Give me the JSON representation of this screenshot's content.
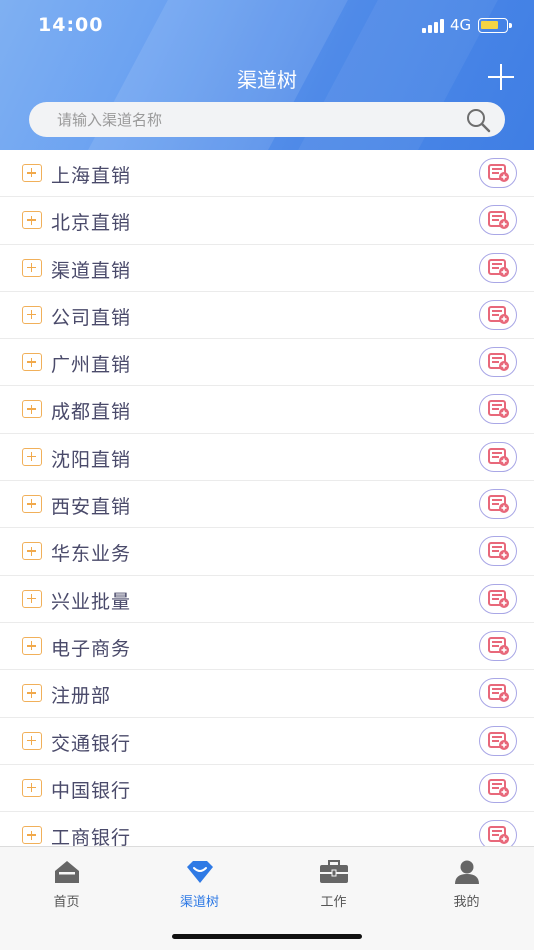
{
  "status": {
    "time": "14:00",
    "network": "4G"
  },
  "nav": {
    "title": "渠道树"
  },
  "search": {
    "placeholder": "请输入渠道名称"
  },
  "channels": [
    "上海直销",
    "北京直销",
    "渠道直销",
    "公司直销",
    "广州直销",
    "成都直销",
    "沈阳直销",
    "西安直销",
    "华东业务",
    "兴业批量",
    "电子商务",
    "注册部",
    "交通银行",
    "中国银行",
    "工商银行"
  ],
  "tabs": [
    {
      "label": "首页",
      "icon": "home-icon"
    },
    {
      "label": "渠道树",
      "icon": "diamond-icon"
    },
    {
      "label": "工作",
      "icon": "briefcase-icon"
    },
    {
      "label": "我的",
      "icon": "user-icon"
    }
  ],
  "active_tab": 1,
  "colors": {
    "accent": "#2f7ae5",
    "expand": "#f1a94b",
    "action_icon": "#e8687a",
    "action_border": "#a9a7e6"
  }
}
